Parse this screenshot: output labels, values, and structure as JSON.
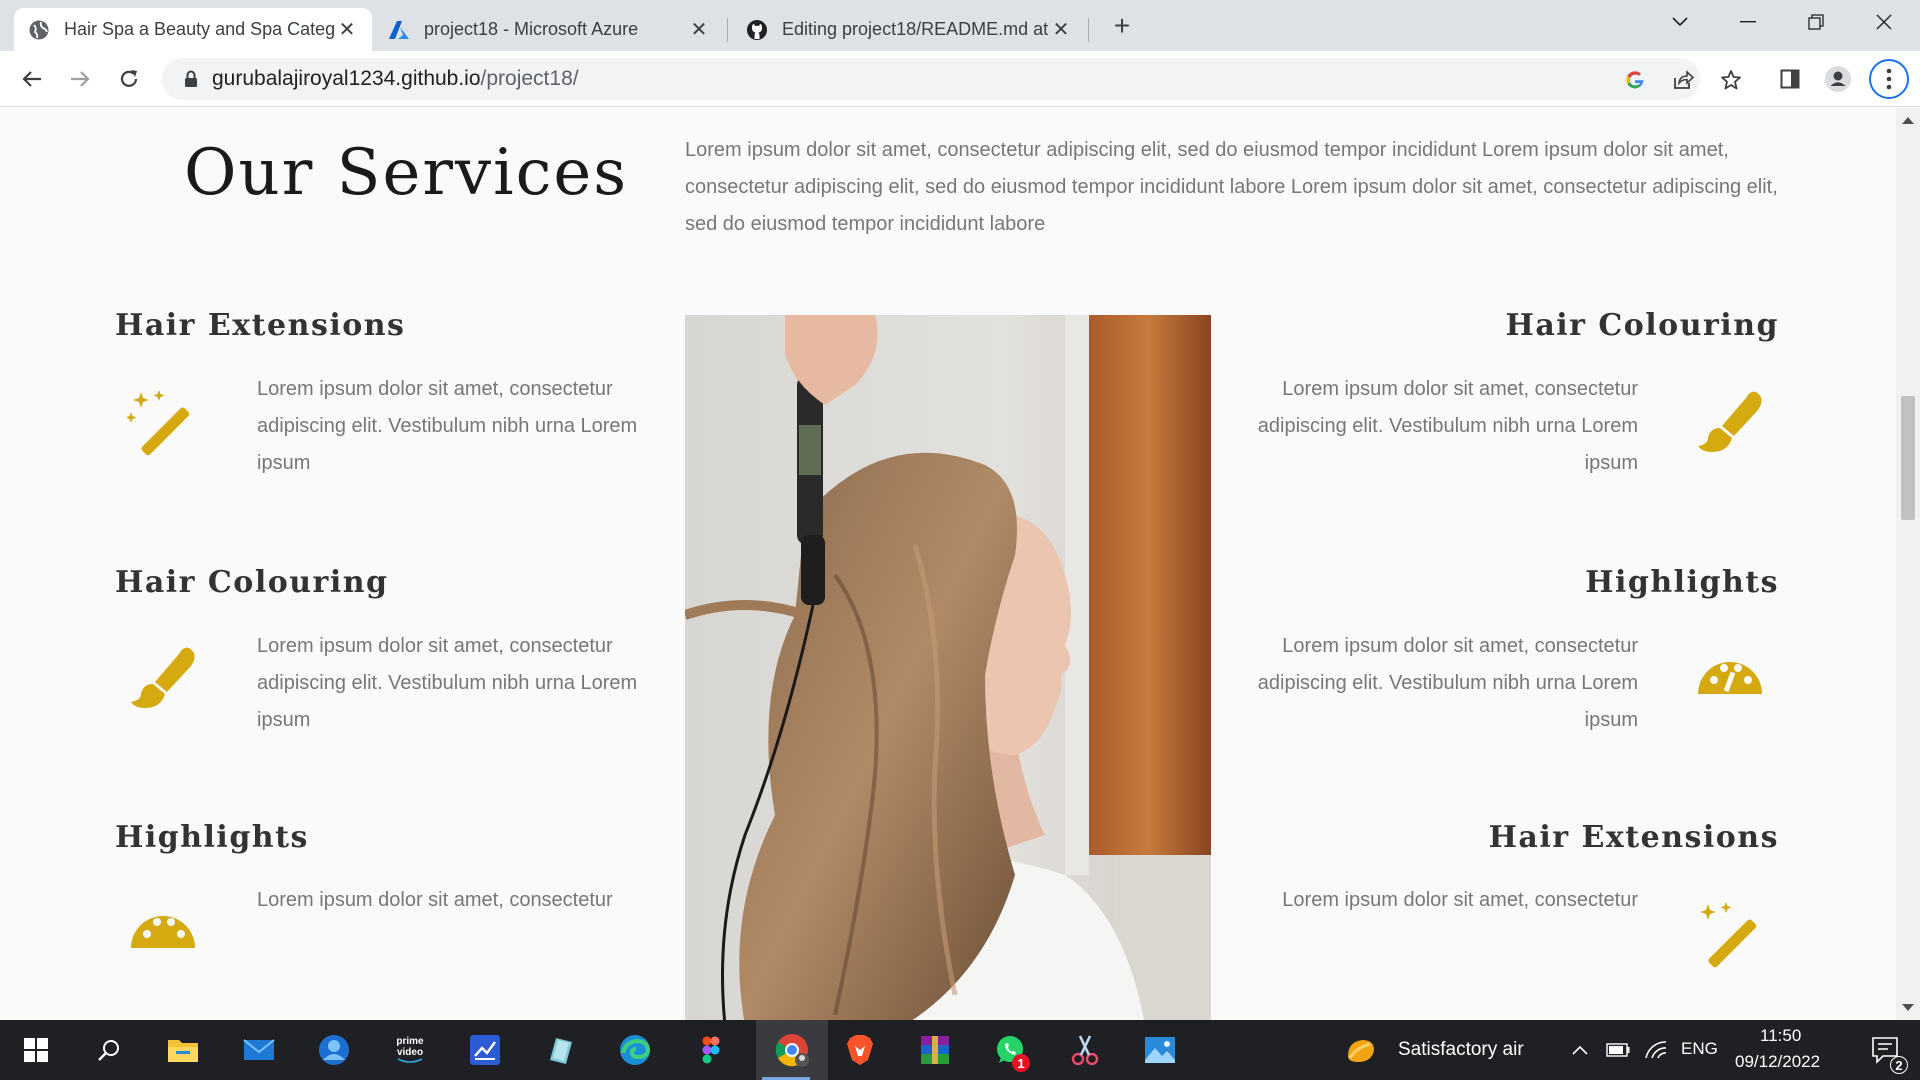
{
  "browser": {
    "tabs": [
      {
        "title": "Hair Spa a Beauty and Spa Categ",
        "active": true
      },
      {
        "title": "project18 - Microsoft Azure",
        "active": false
      },
      {
        "title": "Editing project18/README.md at",
        "active": false
      }
    ],
    "close_glyph": "✕",
    "new_tab_glyph": "+",
    "window_controls": {
      "list": "⌄",
      "minimize": "—",
      "restore": "❐",
      "close": "✕"
    },
    "url": {
      "domain": "gurubalajiroyal1234.github.io",
      "path": "/project18/"
    }
  },
  "page": {
    "section_title": "Our Services",
    "intro": "Lorem ipsum dolor sit amet, consectetur adipiscing elit, sed do eiusmod tempor incididunt Lorem ipsum dolor sit amet, consectetur adipiscing elit, sed do eiusmod tempor incididunt labore Lorem ipsum dolor sit amet, consectetur adipiscing elit, sed do eiusmod tempor incididunt labore",
    "left_services": [
      {
        "title": "Hair Extensions",
        "text": "Lorem ipsum dolor sit amet, consectetur adipiscing elit. Vestibulum nibh urna Lorem ipsum",
        "icon": "magic-wand-icon"
      },
      {
        "title": "Hair Colouring",
        "text": "Lorem ipsum dolor sit amet, consectetur adipiscing elit. Vestibulum nibh urna Lorem ipsum",
        "icon": "paint-brush-icon"
      },
      {
        "title": "Highlights",
        "text": "Lorem ipsum dolor sit amet, consectetur",
        "icon": "palette-icon"
      }
    ],
    "right_services": [
      {
        "title": "Hair Colouring",
        "text": "Lorem ipsum dolor sit amet, consectetur adipiscing elit. Vestibulum nibh urna Lorem ipsum",
        "icon": "paint-brush-icon"
      },
      {
        "title": "Highlights",
        "text": "Lorem ipsum dolor sit amet, consectetur adipiscing elit. Vestibulum nibh urna Lorem ipsum",
        "icon": "palette-icon"
      },
      {
        "title": "Hair Extensions",
        "text": "Lorem ipsum dolor sit amet, consectetur",
        "icon": "magic-wand-icon"
      }
    ],
    "accent_color": "#d4aa10"
  },
  "taskbar": {
    "prime_label": "prime video",
    "weather": "Satisfactory air",
    "language": "ENG",
    "time": "11:50",
    "date": "09/12/2022",
    "whatsapp_badge": "1",
    "notification_count": "2"
  }
}
